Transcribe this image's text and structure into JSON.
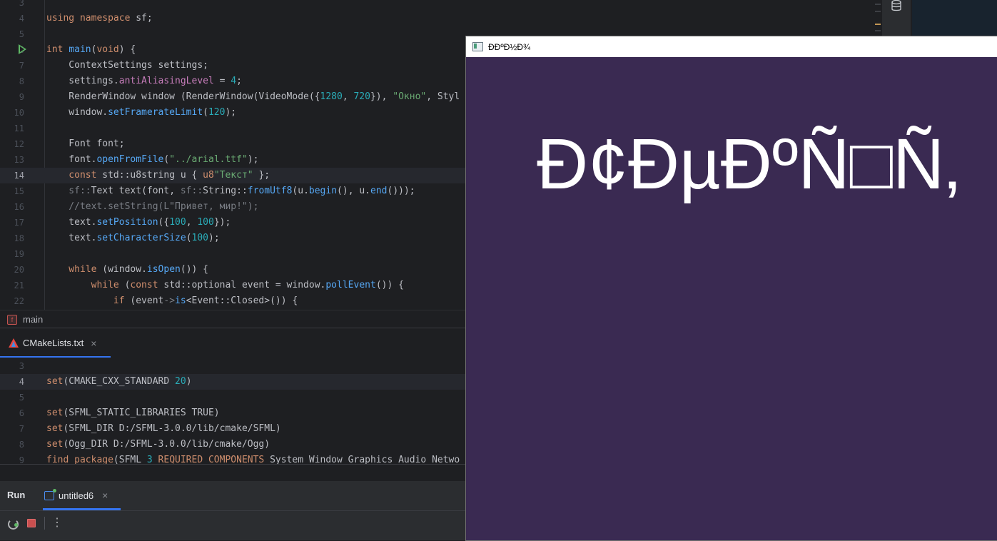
{
  "editor": {
    "lines": [
      {
        "num": "3",
        "tokens": []
      },
      {
        "num": "4",
        "tokens": [
          [
            "kw",
            "using namespace "
          ],
          [
            "typ",
            "sf;"
          ]
        ]
      },
      {
        "num": "5",
        "tokens": []
      },
      {
        "num": "6",
        "tokens": [
          [
            "kw",
            "int "
          ],
          [
            "fn",
            "main"
          ],
          [
            "typ",
            "("
          ],
          [
            "kw",
            "void"
          ],
          [
            "typ",
            ") {"
          ]
        ]
      },
      {
        "num": "7",
        "tokens": [
          [
            "typ",
            "    ContextSettings settings;"
          ]
        ]
      },
      {
        "num": "8",
        "tokens": [
          [
            "typ",
            "    settings."
          ],
          [
            "field",
            "antiAliasingLevel"
          ],
          [
            "typ",
            " = "
          ],
          [
            "num",
            "4"
          ],
          [
            "typ",
            ";"
          ]
        ]
      },
      {
        "num": "9",
        "tokens": [
          [
            "typ",
            "    RenderWindow window (RenderWindow(VideoMode({"
          ],
          [
            "num",
            "1280"
          ],
          [
            "typ",
            ", "
          ],
          [
            "num",
            "720"
          ],
          [
            "typ",
            "}), "
          ],
          [
            "str",
            "\"Окно\""
          ],
          [
            "typ",
            ", Styl"
          ]
        ]
      },
      {
        "num": "10",
        "tokens": [
          [
            "typ",
            "    window."
          ],
          [
            "fn",
            "setFramerateLimit"
          ],
          [
            "typ",
            "("
          ],
          [
            "num",
            "120"
          ],
          [
            "typ",
            ");"
          ]
        ]
      },
      {
        "num": "11",
        "tokens": []
      },
      {
        "num": "12",
        "tokens": [
          [
            "typ",
            "    Font font;"
          ]
        ]
      },
      {
        "num": "13",
        "tokens": [
          [
            "typ",
            "    font."
          ],
          [
            "fn",
            "openFromFile"
          ],
          [
            "typ",
            "("
          ],
          [
            "str",
            "\"../arial.ttf\""
          ],
          [
            "typ",
            ");"
          ]
        ]
      },
      {
        "num": "14",
        "tokens": [
          [
            "kw",
            "    const "
          ],
          [
            "typ",
            "std::u8string u { "
          ],
          [
            "kw",
            "u8"
          ],
          [
            "str",
            "\"Текст\""
          ],
          [
            "typ",
            " };"
          ]
        ]
      },
      {
        "num": "15",
        "tokens": [
          [
            "cmt",
            "    sf::"
          ],
          [
            "typ",
            "Text text(font, "
          ],
          [
            "cmt",
            "sf::"
          ],
          [
            "typ",
            "String::"
          ],
          [
            "fn",
            "fromUtf8"
          ],
          [
            "typ",
            "(u."
          ],
          [
            "fn",
            "begin"
          ],
          [
            "typ",
            "(), u."
          ],
          [
            "fn",
            "end"
          ],
          [
            "typ",
            "()));"
          ]
        ]
      },
      {
        "num": "16",
        "tokens": [
          [
            "cmt",
            "    //text.setString(L\"Привет, мир!\");"
          ]
        ]
      },
      {
        "num": "17",
        "tokens": [
          [
            "typ",
            "    text."
          ],
          [
            "fn",
            "setPosition"
          ],
          [
            "typ",
            "({"
          ],
          [
            "num",
            "100"
          ],
          [
            "typ",
            ", "
          ],
          [
            "num",
            "100"
          ],
          [
            "typ",
            "});"
          ]
        ]
      },
      {
        "num": "18",
        "tokens": [
          [
            "typ",
            "    text."
          ],
          [
            "fn",
            "setCharacterSize"
          ],
          [
            "typ",
            "("
          ],
          [
            "num",
            "100"
          ],
          [
            "typ",
            ");"
          ]
        ]
      },
      {
        "num": "19",
        "tokens": []
      },
      {
        "num": "20",
        "tokens": [
          [
            "kw",
            "    while "
          ],
          [
            "typ",
            "(window."
          ],
          [
            "fn",
            "isOpen"
          ],
          [
            "typ",
            "()) {"
          ]
        ]
      },
      {
        "num": "21",
        "tokens": [
          [
            "kw",
            "        while "
          ],
          [
            "typ",
            "("
          ],
          [
            "kw",
            "const "
          ],
          [
            "typ",
            "std::optional event = window."
          ],
          [
            "fn",
            "pollEvent"
          ],
          [
            "typ",
            "()) {"
          ]
        ]
      },
      {
        "num": "22",
        "tokens": [
          [
            "kw",
            "            if "
          ],
          [
            "typ",
            "(event"
          ],
          [
            "cmt",
            "->"
          ],
          [
            "fn",
            "is"
          ],
          [
            "typ",
            "<Event::Closed>()) {"
          ]
        ]
      }
    ]
  },
  "breadcrumb": {
    "icon_letter": "f",
    "label": "main"
  },
  "cmake_tab": {
    "label": "CMakeLists.txt",
    "close": "×"
  },
  "cmake": {
    "lines": [
      {
        "num": "3",
        "tokens": []
      },
      {
        "num": "4",
        "tokens": [
          [
            "kw",
            "set"
          ],
          [
            "typ",
            "(CMAKE_CXX_STANDARD "
          ],
          [
            "num",
            "20"
          ],
          [
            "typ",
            ")"
          ]
        ]
      },
      {
        "num": "5",
        "tokens": []
      },
      {
        "num": "6",
        "tokens": [
          [
            "kw",
            "set"
          ],
          [
            "typ",
            "(SFML_STATIC_LIBRARIES TRUE)"
          ]
        ]
      },
      {
        "num": "7",
        "tokens": [
          [
            "kw",
            "set"
          ],
          [
            "typ",
            "(SFML_DIR D:/SFML-3.0.0/lib/cmake/SFML)"
          ]
        ]
      },
      {
        "num": "8",
        "tokens": [
          [
            "kw",
            "set"
          ],
          [
            "typ",
            "(Ogg_DIR D:/SFML-3.0.0/lib/cmake/Ogg)"
          ]
        ]
      },
      {
        "num": "9",
        "tokens": [
          [
            "kw",
            "find_package"
          ],
          [
            "typ",
            "(SFML "
          ],
          [
            "num",
            "3"
          ],
          [
            "kw",
            " REQUIRED COMPONENTS"
          ],
          [
            "typ",
            " System Window Graphics Audio Netwo"
          ]
        ]
      }
    ]
  },
  "run_panel": {
    "title": "Run",
    "tab_label": "untitled6",
    "tab_close": "×",
    "more": "⋮"
  },
  "app_window": {
    "title": "ÐÐºÐ½Ð¾",
    "rendered_text": "Ð¢ÐµÐºÑ□Ñ‚"
  },
  "colors": {
    "canvas": "#3a2a52",
    "accent": "#3574f0"
  }
}
